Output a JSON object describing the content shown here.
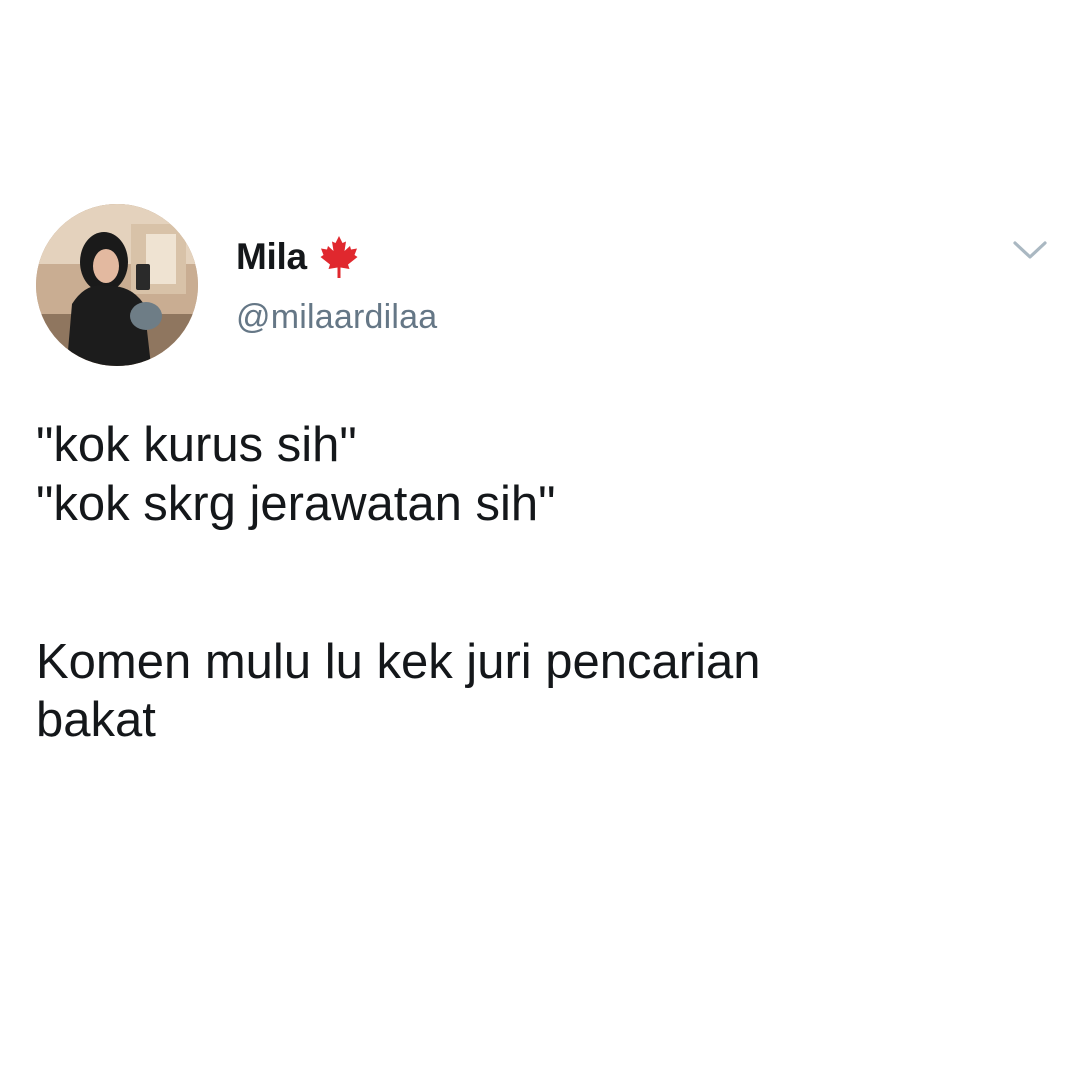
{
  "author": {
    "display_name": "Mila",
    "handle": "@milaardilaa",
    "badge_icon": "maple-leaf-icon",
    "badge_color": "#e0282e"
  },
  "menu": {
    "icon": "chevron-down-icon",
    "color": "#aab8c2"
  },
  "tweet": {
    "line1": "\"kok kurus sih\"",
    "line2": "\"kok skrg jerawatan sih\"",
    "line3": "Komen mulu lu kek juri pencarian",
    "line4": "bakat"
  },
  "colors": {
    "text": "#14171a",
    "secondary": "#657786",
    "background": "#ffffff"
  }
}
